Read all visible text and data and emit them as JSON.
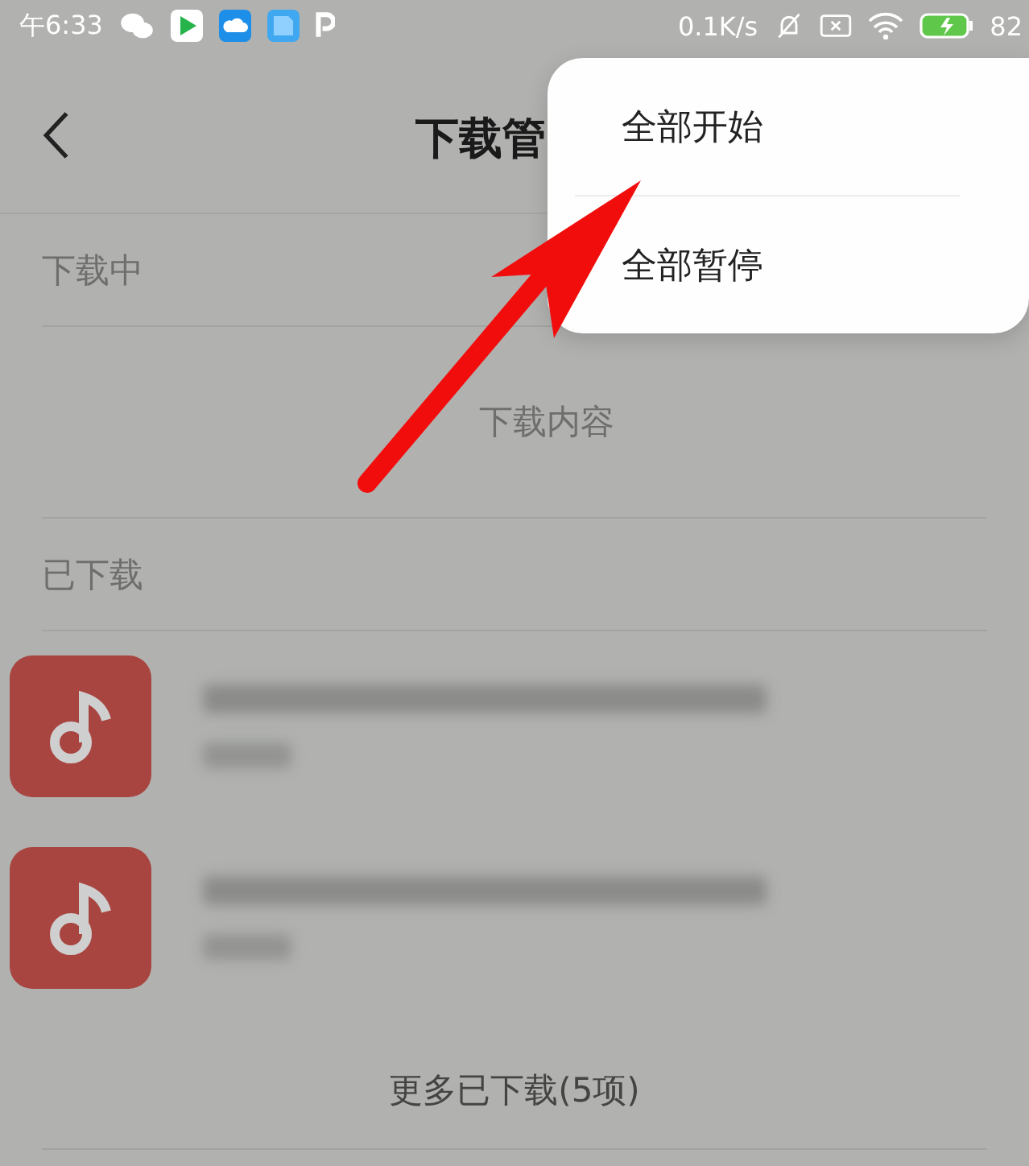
{
  "status_bar": {
    "time": "午6:33",
    "speed": "0.1K/s",
    "battery": "82"
  },
  "header": {
    "title": "下载管"
  },
  "downloading": {
    "label": "下载中",
    "empty_text": "下载内容"
  },
  "downloaded": {
    "label": "已下载",
    "items": [
      {
        "kind": "music-file"
      },
      {
        "kind": "music-file"
      }
    ],
    "more": "更多已下载(5项)"
  },
  "menu": {
    "items": [
      "全部开始",
      "全部暂停"
    ]
  }
}
